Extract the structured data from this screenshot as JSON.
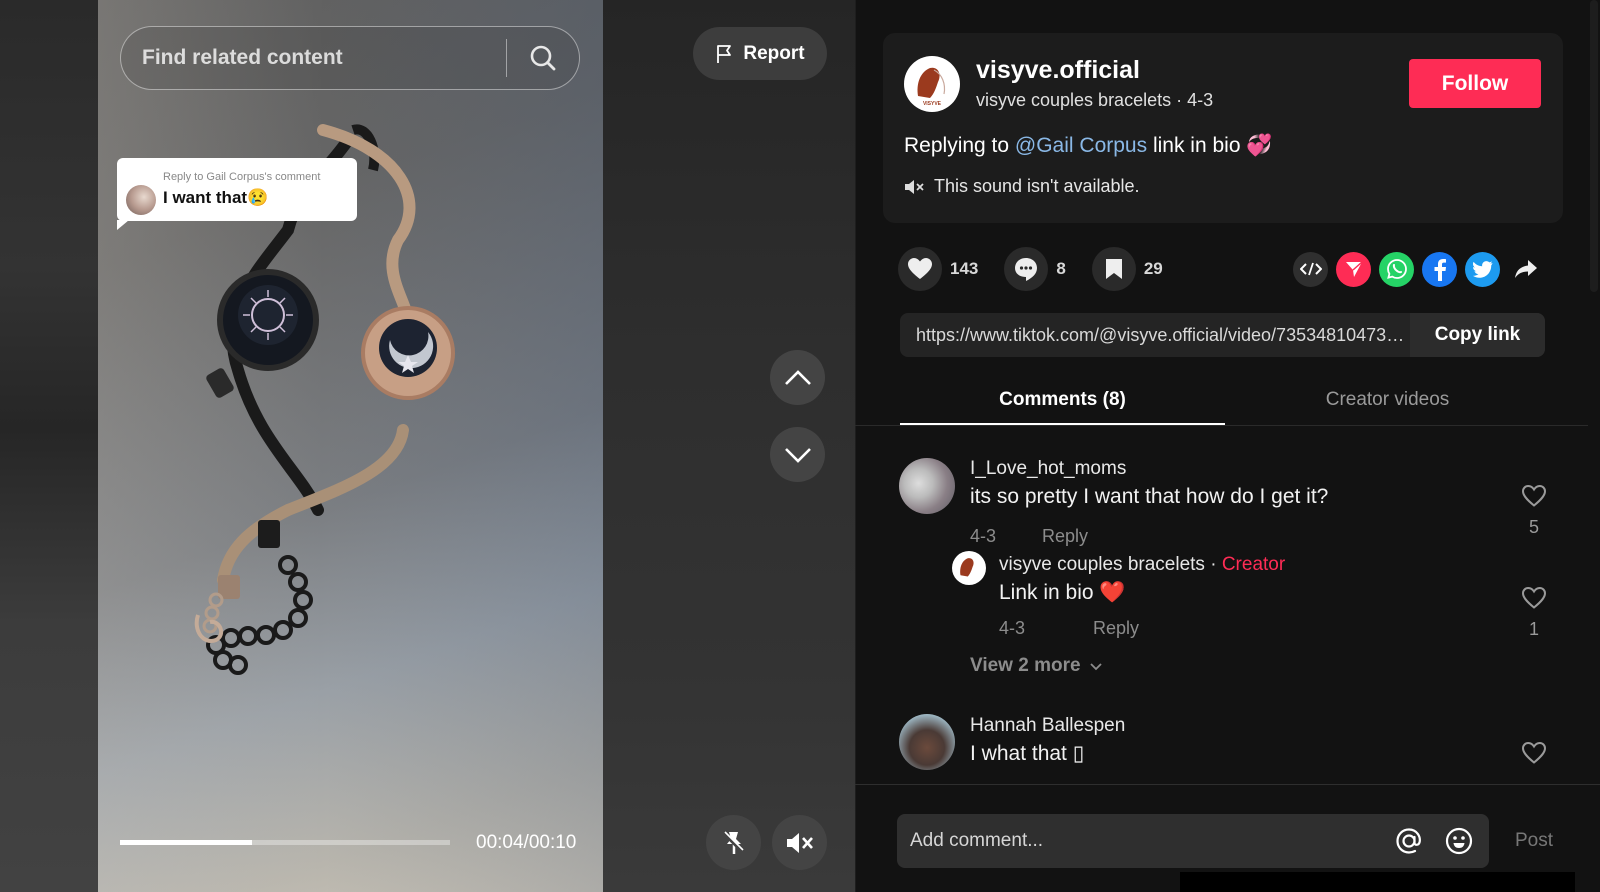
{
  "video": {
    "search_placeholder": "Find related content",
    "reply_bubble": {
      "heading": "Reply to Gail Corpus's comment",
      "text": "I want that😢"
    },
    "progress_fraction": 0.4,
    "time": "00:04/00:10",
    "report_label": "Report"
  },
  "author": {
    "username": "visyve.official",
    "avatar_text": "VISYVE",
    "subtitle": "visyve couples bracelets · 4-3",
    "follow_label": "Follow",
    "desc_prefix": "Replying to ",
    "desc_mention": "@Gail Corpus",
    "desc_suffix": " link in bio 💞",
    "sound": "This sound isn't available."
  },
  "stats": {
    "likes": "143",
    "comments": "8",
    "saves": "29"
  },
  "share": {
    "icons": [
      "embed-icon",
      "send-to-friends-icon",
      "whatsapp-icon",
      "facebook-icon",
      "twitter-icon",
      "share-arrow-icon"
    ]
  },
  "link": {
    "url": "https://www.tiktok.com/@visyve.official/video/7353481047389...",
    "copy_label": "Copy link"
  },
  "tabs": [
    {
      "label": "Comments (8)",
      "active": true
    },
    {
      "label": "Creator videos",
      "active": false
    }
  ],
  "comments": [
    {
      "user": "I_Love_hot_moms",
      "text": "its so pretty I want that how do I get it?",
      "date": "4-3",
      "reply_label": "Reply",
      "likes": "5",
      "replies": [
        {
          "user": "visyve couples bracelets",
          "separator": " · ",
          "tag": "Creator",
          "text": "Link in bio ❤️",
          "date": "4-3",
          "reply_label": "Reply",
          "likes": "1"
        }
      ],
      "view_more": "View 2 more"
    },
    {
      "user": "Hannah Ballespen",
      "text": "I what that ▯",
      "likes": ""
    }
  ],
  "composer": {
    "placeholder": "Add comment...",
    "post_label": "Post"
  },
  "colors": {
    "accent": "#fe2c55",
    "mention": "#8ab8e6",
    "whatsapp": "#25d366",
    "facebook": "#1877f2",
    "twitter": "#1d9bf0"
  }
}
